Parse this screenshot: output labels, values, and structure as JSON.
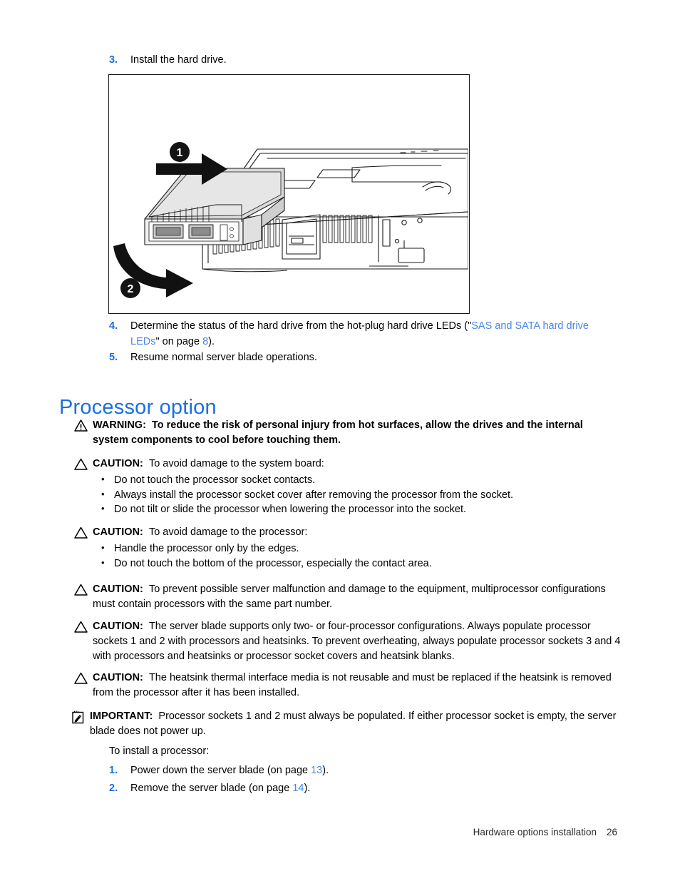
{
  "steps_top": [
    {
      "num": "3.",
      "text": "Install the hard drive."
    }
  ],
  "figure": {
    "name": "hard-drive-installation-illustration",
    "callouts": [
      {
        "id": "1",
        "label": "1"
      },
      {
        "id": "2",
        "label": "2"
      }
    ]
  },
  "steps_after_figure": [
    {
      "num": "4.",
      "pre": "Determine the status of the hard drive from the hot-plug hard drive LEDs (\"",
      "link": "SAS and SATA hard drive LEDs",
      "mid": "\" on page ",
      "page_link": "8",
      "post": ")."
    },
    {
      "num": "5.",
      "pre": "Resume normal server blade operations.",
      "link": "",
      "mid": "",
      "page_link": "",
      "post": ""
    }
  ],
  "heading": "Processor option",
  "notices": [
    {
      "icon": "warning-triangle-exclamation-icon",
      "label": "WARNING:",
      "bold_body": true,
      "text": "To reduce the risk of personal injury from hot surfaces, allow the drives and the internal system components to cool before touching them.",
      "bullets": []
    },
    {
      "icon": "caution-triangle-icon",
      "label": "CAUTION:",
      "bold_body": false,
      "text": "To avoid damage to the system board:",
      "bullets": [
        "Do not touch the processor socket contacts.",
        "Always install the processor socket cover after removing the processor from the socket.",
        "Do not tilt or slide the processor when lowering the processor into the socket."
      ]
    },
    {
      "icon": "caution-triangle-icon",
      "label": "CAUTION:",
      "bold_body": false,
      "text": "To avoid damage to the processor:",
      "bullets": [
        "Handle the processor only by the edges.",
        "Do not touch the bottom of the processor, especially the contact area."
      ]
    },
    {
      "icon": "caution-triangle-icon",
      "label": "CAUTION:",
      "bold_body": false,
      "text": "To prevent possible server malfunction and damage to the equipment, multiprocessor configurations must contain processors with the same part number.",
      "bullets": []
    },
    {
      "icon": "caution-triangle-icon",
      "label": "CAUTION:",
      "bold_body": false,
      "text": "The server blade supports only two- or four-processor configurations. Always populate processor sockets 1 and 2 with processors and heatsinks. To prevent overheating, always populate processor sockets 3 and 4 with processors and heatsinks or processor socket covers and heatsink blanks.",
      "bullets": []
    },
    {
      "icon": "caution-triangle-icon",
      "label": "CAUTION:",
      "bold_body": false,
      "text": "The heatsink thermal interface media is not reusable and must be replaced if the heatsink is removed from the processor after it has been installed.",
      "bullets": []
    },
    {
      "icon": "important-note-hand-icon",
      "label": "IMPORTANT:",
      "bold_body": false,
      "text": "Processor sockets 1 and 2 must always be populated. If either processor socket is empty, the server blade does not power up.",
      "bullets": []
    }
  ],
  "intro_line": "To install a processor:",
  "steps_bottom": [
    {
      "num": "1.",
      "pre": "Power down the server blade (on page ",
      "page_link": "13",
      "post": ")."
    },
    {
      "num": "2.",
      "pre": "Remove the server blade (on page ",
      "page_link": "14",
      "post": ")."
    }
  ],
  "footer": {
    "text": "Hardware options installation",
    "page": "26"
  },
  "colors": {
    "heading_blue": "#1a6fe0",
    "link_blue": "#4a85e8",
    "number_blue": "#1a6fe0",
    "ink": "#000000"
  }
}
